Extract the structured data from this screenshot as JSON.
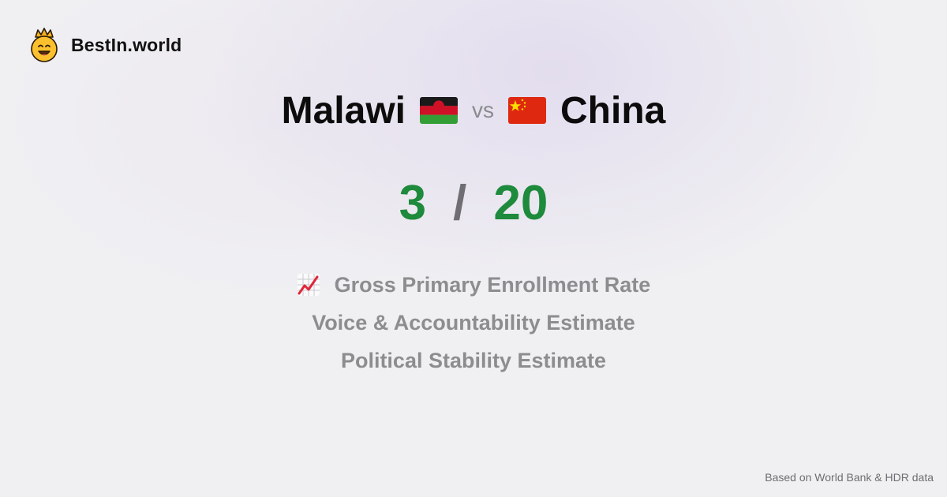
{
  "brand": {
    "name": "BestIn.world",
    "logo_icon": "crowned-smiley-icon"
  },
  "comparison": {
    "left": {
      "country": "Malawi",
      "flag_icon": "malawi-flag-icon"
    },
    "vs_label": "vs",
    "right": {
      "country": "China",
      "flag_icon": "china-flag-icon"
    }
  },
  "score": {
    "left": "3",
    "separator": "/",
    "right": "20",
    "color": "#1e8a3c"
  },
  "metrics": [
    {
      "label": "Gross Primary Enrollment Rate",
      "icon": "chart-increasing-icon"
    },
    {
      "label": "Voice & Accountability Estimate"
    },
    {
      "label": "Political Stability Estimate"
    }
  ],
  "footer": {
    "source": "Based on World Bank & HDR data"
  }
}
